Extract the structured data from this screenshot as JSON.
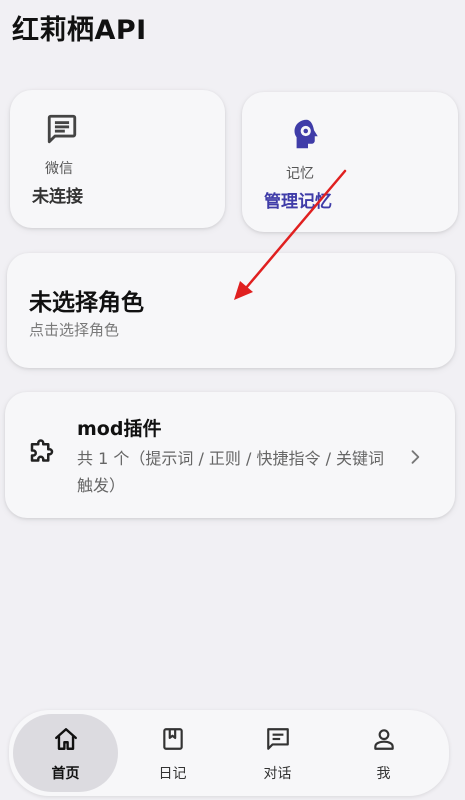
{
  "app": {
    "title": "红莉栖API"
  },
  "wechat": {
    "label": "微信",
    "status": "未连接"
  },
  "memory": {
    "label": "记忆",
    "action": "管理记忆"
  },
  "role": {
    "title": "未选择角色",
    "subtitle": "点击选择角色"
  },
  "mod": {
    "title": "mod插件",
    "desc": "共 1 个（提示词 / 正则 / 快捷指令 / 关键词触发）"
  },
  "nav": {
    "home": "首页",
    "diary": "日记",
    "chat": "对话",
    "me": "我"
  },
  "colors": {
    "accent": "#3f3ca8",
    "arrow": "#e02020",
    "background": "#f1f0f4"
  }
}
